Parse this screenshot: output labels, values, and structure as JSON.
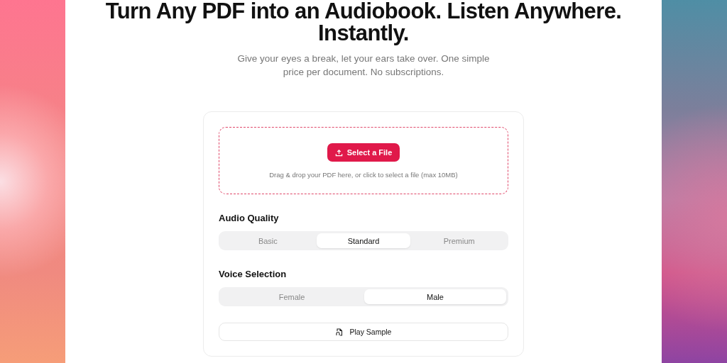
{
  "hero": {
    "title_lines": [
      "Turn Any PDF into an Audiobook. Listen Anywhere.",
      "Instantly."
    ],
    "subtitle": "Give your eyes a break, let your ears take over. One simple price per document. No subscriptions."
  },
  "upload": {
    "button": "Select a File",
    "hint": "Drag & drop your PDF here, or click to select a file (max 10MB)"
  },
  "audio_quality": {
    "label": "Audio Quality",
    "options": [
      {
        "label": "Basic",
        "selected": false
      },
      {
        "label": "Standard",
        "selected": true
      },
      {
        "label": "Premium",
        "selected": false
      }
    ]
  },
  "voice_selection": {
    "label": "Voice Selection",
    "options": [
      {
        "label": "Female",
        "selected": false
      },
      {
        "label": "Male",
        "selected": true
      }
    ]
  },
  "play_sample": {
    "label": "Play Sample"
  }
}
